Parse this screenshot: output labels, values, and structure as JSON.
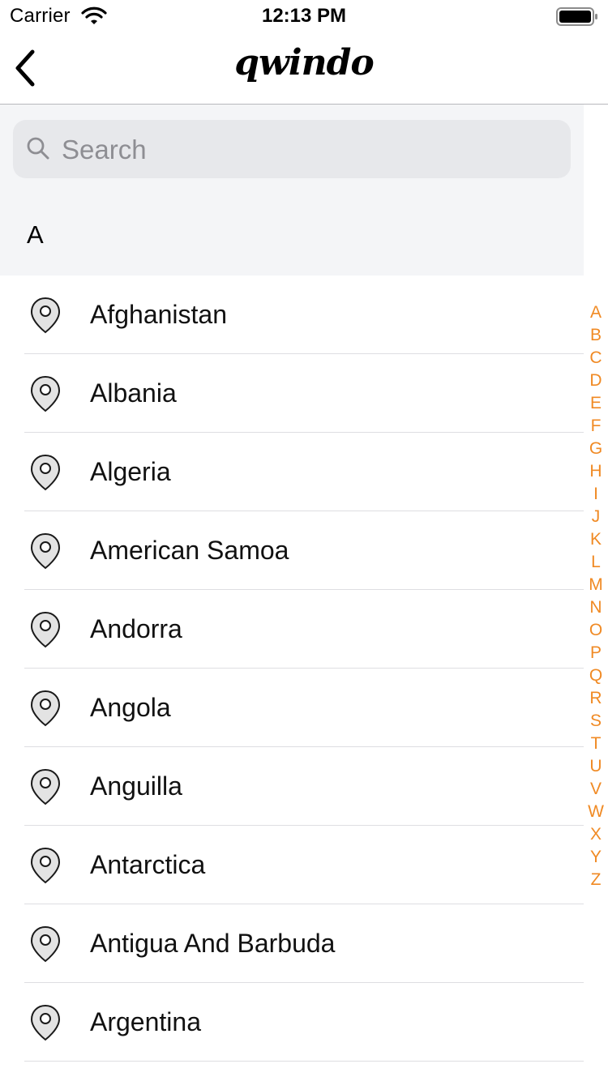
{
  "status_bar": {
    "carrier": "Carrier",
    "time": "12:13 PM"
  },
  "nav": {
    "back_icon": "chevron-left-icon",
    "logo_text": "qwindo"
  },
  "search": {
    "placeholder": "Search",
    "value": "",
    "icon": "search-icon"
  },
  "section": {
    "letter": "A"
  },
  "countries": [
    "Afghanistan",
    "Albania",
    "Algeria",
    "American Samoa",
    "Andorra",
    "Angola",
    "Anguilla",
    "Antarctica",
    "Antigua And Barbuda",
    "Argentina"
  ],
  "index": [
    "A",
    "B",
    "C",
    "D",
    "E",
    "F",
    "G",
    "H",
    "I",
    "J",
    "K",
    "L",
    "M",
    "N",
    "O",
    "P",
    "Q",
    "R",
    "S",
    "T",
    "U",
    "V",
    "W",
    "X",
    "Y",
    "Z"
  ],
  "colors": {
    "accent": "#f08a24",
    "header_bg": "#f4f5f7",
    "search_bg": "#e7e8eb"
  }
}
